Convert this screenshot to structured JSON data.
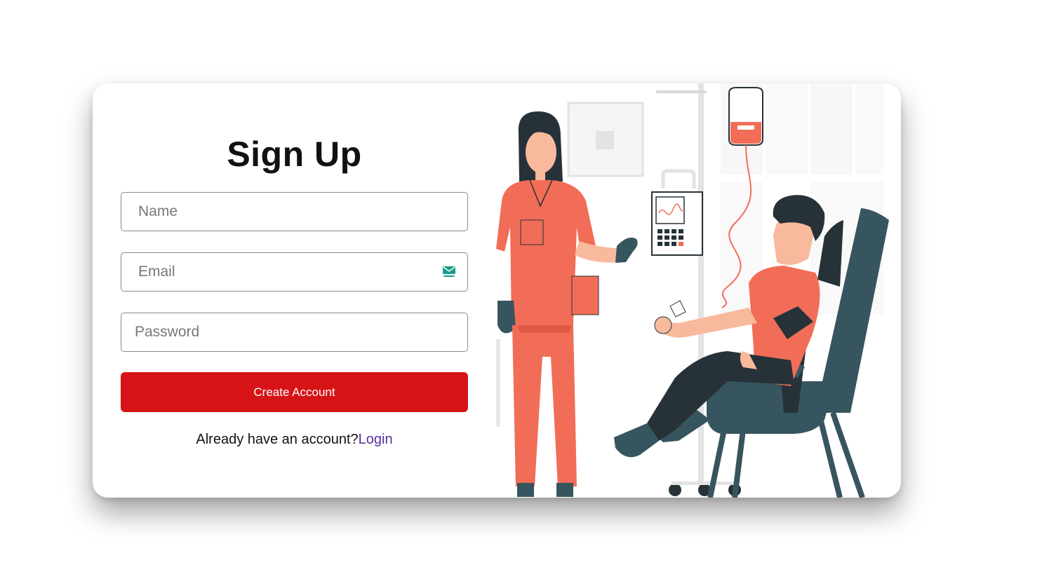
{
  "form": {
    "title": "Sign Up",
    "name_placeholder": "Name",
    "email_placeholder": "Email",
    "password_placeholder": "Password",
    "submit_label": "Create Account",
    "login_prompt": "Already have an account?",
    "login_link": "Login"
  },
  "colors": {
    "primary_button": "#d61417",
    "link": "#5b2da0",
    "illustration_accent": "#f26d57",
    "chair": "#37555e"
  },
  "icons": {
    "email_field_icon": "mail-icon",
    "illustration": "blood-donation-illustration"
  }
}
